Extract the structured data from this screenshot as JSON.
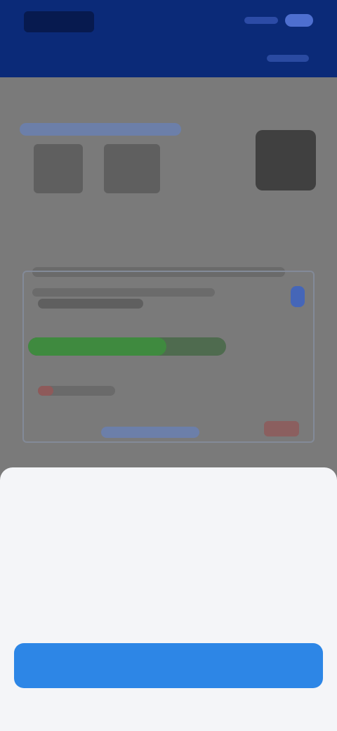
{
  "header": {
    "logo_text": "",
    "menu_label": ""
  },
  "main": {
    "section_title": "",
    "stat_a": "",
    "stat_b": "",
    "avatar_label": "",
    "panel": {
      "progress_percent": 70,
      "link_text": "",
      "badge_text": ""
    }
  },
  "sheet": {
    "title": "",
    "subtitle": "",
    "body_lines": [],
    "cta_label": ""
  }
}
